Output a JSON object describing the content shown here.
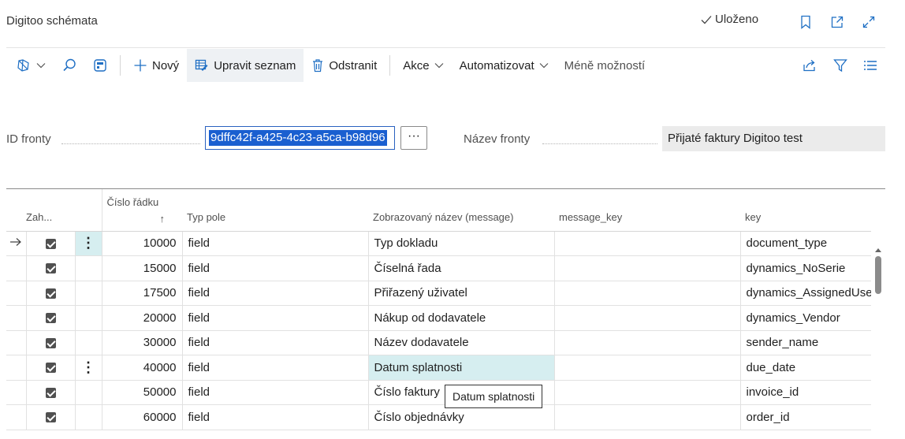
{
  "header": {
    "title": "Digitoo schémata",
    "saved_label": "Uloženo"
  },
  "toolbar": {
    "new_label": "Nový",
    "edit_list_label": "Upravit seznam",
    "delete_label": "Odstranit",
    "actions_label": "Akce",
    "automate_label": "Automatizovat",
    "fewer_options_label": "Méně možností"
  },
  "fields": {
    "queue_id_label": "ID fronty",
    "queue_id_value": "9dffc42f-a425-4c23-a5ca-b98d96",
    "assist_label": "···",
    "queue_name_label": "Název fronty",
    "queue_name_value": "Přijaté faktury Digitoo test"
  },
  "grid": {
    "columns": {
      "include": "Zah...",
      "line_no": "Číslo řádku",
      "sort_arrow": "↑",
      "field_type": "Typ pole",
      "display_name": "Zobrazovaný název (message)",
      "message_key": "message_key",
      "key": "key"
    },
    "rows": [
      {
        "line_no": "10000",
        "type": "field",
        "name": "Typ dokladu",
        "message_key": "",
        "key": "document_type"
      },
      {
        "line_no": "15000",
        "type": "field",
        "name": "Číselná řada",
        "message_key": "",
        "key": "dynamics_NoSerie"
      },
      {
        "line_no": "17500",
        "type": "field",
        "name": "Přiřazený uživatel",
        "message_key": "",
        "key": "dynamics_AssignedUse"
      },
      {
        "line_no": "20000",
        "type": "field",
        "name": "Nákup od dodavatele",
        "message_key": "",
        "key": "dynamics_Vendor"
      },
      {
        "line_no": "30000",
        "type": "field",
        "name": "Název dodavatele",
        "message_key": "",
        "key": "sender_name"
      },
      {
        "line_no": "40000",
        "type": "field",
        "name": "Datum splatnosti",
        "message_key": "",
        "key": "due_date"
      },
      {
        "line_no": "50000",
        "type": "field",
        "name": "Číslo faktury",
        "message_key": "",
        "key": "invoice_id"
      },
      {
        "line_no": "60000",
        "type": "field",
        "name": "Číslo objednávky",
        "message_key": "",
        "key": "order_id"
      }
    ]
  },
  "tooltip": {
    "text": "Datum splatnosti"
  },
  "colors": {
    "accent": "#1f6fc4",
    "selection": "#1a5fd0",
    "row_highlight": "#d6eef0"
  }
}
